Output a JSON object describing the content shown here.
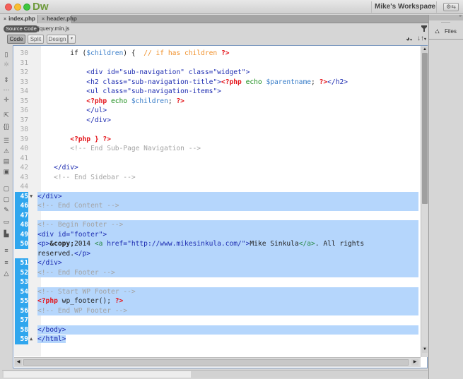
{
  "app": {
    "logo": "Dw",
    "workspace": "Mike's Workspace",
    "workspace_caret": "▾",
    "sync_icon": "sync-icon"
  },
  "tabs": [
    {
      "label": "index.php",
      "active": true,
      "close": "×"
    },
    {
      "label": "header.php",
      "active": false,
      "close": "×"
    }
  ],
  "related_files": {
    "source_code": "Source Code",
    "file": "jquery.min.js"
  },
  "view_buttons": {
    "code": "Code",
    "split": "Split",
    "design": "Design",
    "dropdown": "▾"
  },
  "right_panel": {
    "files_label": "Files"
  },
  "editor": {
    "scroll_vertical_percent": 48,
    "lines": [
      {
        "n": "30",
        "tokens": [
          [
            "pl",
            "        if ("
          ],
          [
            "var",
            "$children"
          ],
          [
            "pl",
            ") {  "
          ],
          [
            "orange",
            "// if has children "
          ],
          [
            "php",
            "?>"
          ]
        ]
      },
      {
        "n": "31",
        "tokens": []
      },
      {
        "n": "32",
        "tokens": [
          [
            "tag",
            "            <div id=\"sub-navigation\" class=\"widget\">"
          ]
        ]
      },
      {
        "n": "33",
        "tokens": [
          [
            "tag",
            "            <h2 class=\"sub-navigation-title\">"
          ],
          [
            "php",
            "<?php"
          ],
          [
            "kw",
            " echo "
          ],
          [
            "var",
            "$parentname"
          ],
          [
            "pl",
            "; "
          ],
          [
            "php",
            "?>"
          ],
          [
            "tag",
            "</h2>"
          ]
        ]
      },
      {
        "n": "34",
        "tokens": [
          [
            "tag",
            "            <ul class=\"sub-navigation-items\">"
          ]
        ]
      },
      {
        "n": "35",
        "tokens": [
          [
            "php",
            "            <?php"
          ],
          [
            "kw",
            " echo "
          ],
          [
            "var",
            "$children"
          ],
          [
            "pl",
            "; "
          ],
          [
            "php",
            "?>"
          ]
        ]
      },
      {
        "n": "36",
        "tokens": [
          [
            "tag",
            "            </ul>"
          ]
        ]
      },
      {
        "n": "37",
        "tokens": [
          [
            "tag",
            "            </div>"
          ]
        ]
      },
      {
        "n": "38",
        "tokens": []
      },
      {
        "n": "39",
        "tokens": [
          [
            "php",
            "        <?php } ?>"
          ]
        ]
      },
      {
        "n": "40",
        "tokens": [
          [
            "cmt",
            "        <!-- End Sub-Page Navigation -->"
          ]
        ]
      },
      {
        "n": "41",
        "tokens": []
      },
      {
        "n": "42",
        "tokens": [
          [
            "tag",
            "    </div>"
          ]
        ]
      },
      {
        "n": "43",
        "tokens": [
          [
            "cmt",
            "    <!-- End Sidebar -->"
          ]
        ]
      },
      {
        "n": "44",
        "tokens": []
      },
      {
        "n": "45",
        "sel": true,
        "fold": "▼",
        "tokens": [
          [
            "tag",
            "</div>"
          ]
        ]
      },
      {
        "n": "46",
        "sel": true,
        "tokens": [
          [
            "cmt",
            "<!-- End Content -->"
          ]
        ]
      },
      {
        "n": "47",
        "sel": true,
        "tokens": []
      },
      {
        "n": "48",
        "sel": true,
        "tokens": [
          [
            "cmt",
            "<!-- Begin Footer -->"
          ]
        ]
      },
      {
        "n": "49",
        "sel": true,
        "tokens": [
          [
            "tag",
            "<div id=\"footer\">"
          ]
        ]
      },
      {
        "n": "50",
        "sel": true,
        "wrap": true,
        "tokens": [
          [
            "tag",
            "<p>"
          ],
          [
            "bold",
            "&copy;"
          ],
          [
            "pl",
            "2014 "
          ],
          [
            "atag",
            "<a "
          ],
          [
            "tag",
            "href=\"http://www.mikesinkula.com/\">"
          ],
          [
            "pl",
            "Mike Sinkula"
          ],
          [
            "atag",
            "</a>"
          ],
          [
            "pl",
            ". All rights\nreserved."
          ],
          [
            "tag",
            "</p>"
          ]
        ]
      },
      {
        "n": "51",
        "sel": true,
        "tokens": [
          [
            "tag",
            "</div>"
          ]
        ]
      },
      {
        "n": "52",
        "sel": true,
        "tokens": [
          [
            "cmt",
            "<!-- End Footer -->"
          ]
        ]
      },
      {
        "n": "53",
        "sel": true,
        "tokens": []
      },
      {
        "n": "54",
        "sel": true,
        "tokens": [
          [
            "cmt",
            "<!-- Start WP Footer -->"
          ]
        ]
      },
      {
        "n": "55",
        "sel": true,
        "tokens": [
          [
            "php",
            "<?php"
          ],
          [
            "pl",
            " wp_footer(); "
          ],
          [
            "php",
            "?>"
          ]
        ]
      },
      {
        "n": "56",
        "sel": true,
        "tokens": [
          [
            "cmt",
            "<!-- End WP Footer -->"
          ]
        ]
      },
      {
        "n": "57",
        "sel": true,
        "tokens": []
      },
      {
        "n": "58",
        "sel": true,
        "tokens": [
          [
            "tag",
            "</body>"
          ]
        ]
      },
      {
        "n": "59",
        "sel": true,
        "partial": true,
        "fold": "▲",
        "tokens": [
          [
            "tag",
            "</html>"
          ]
        ]
      }
    ]
  }
}
